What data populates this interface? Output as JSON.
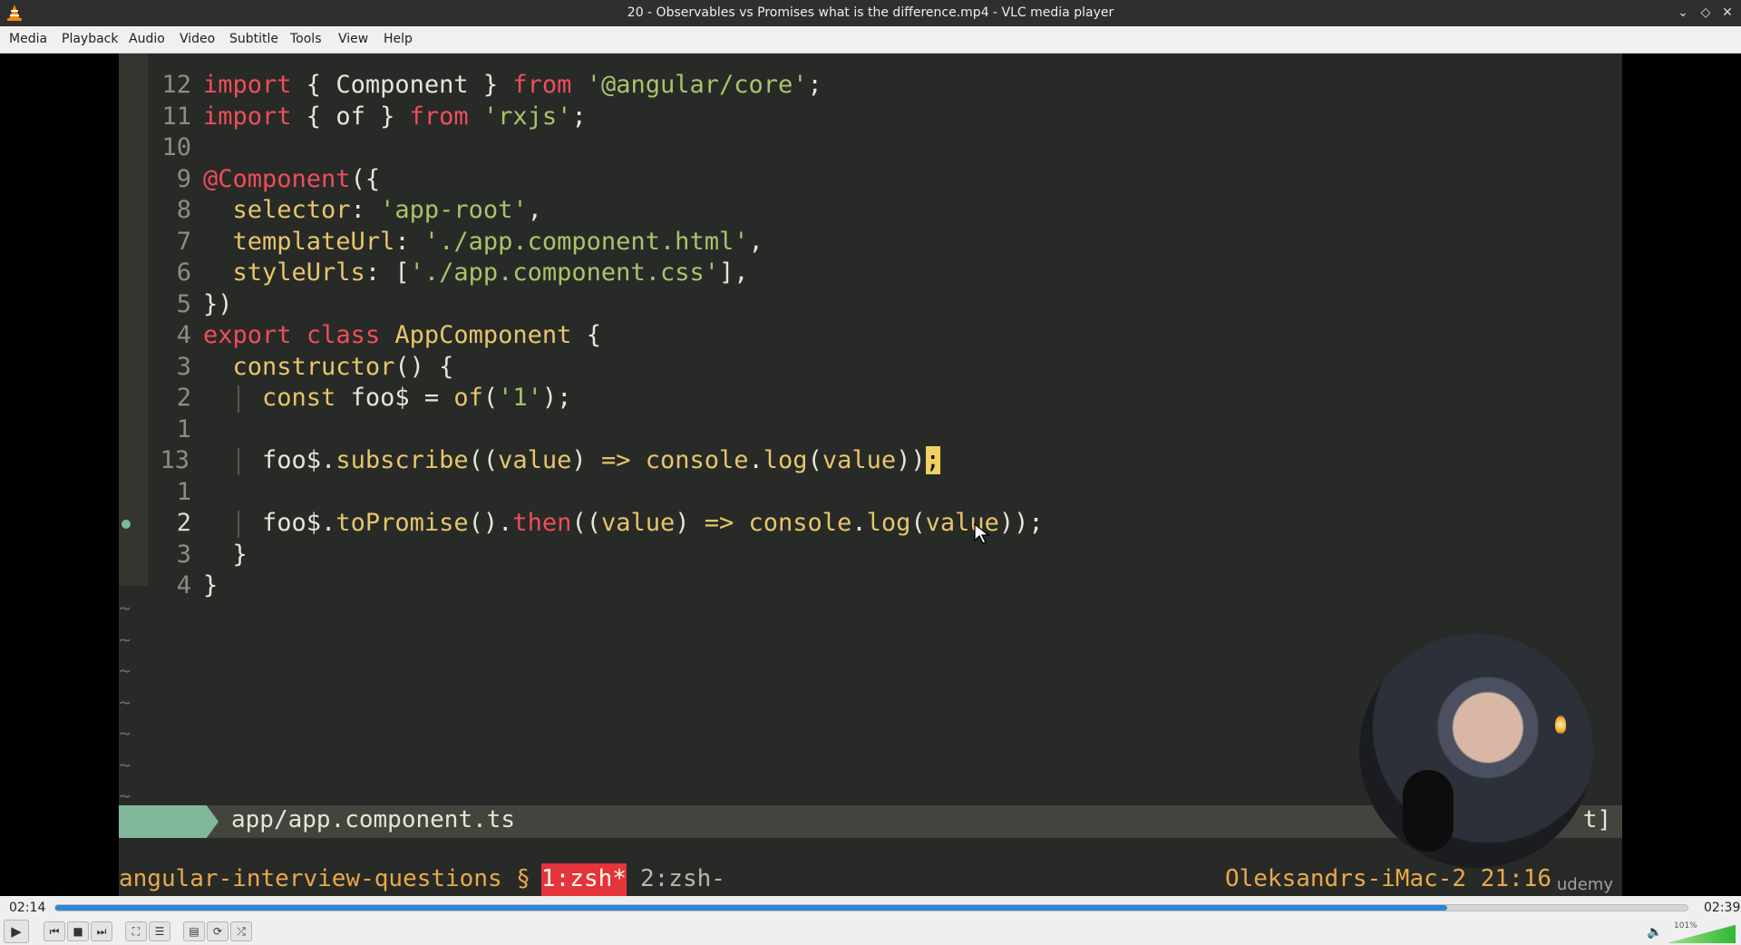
{
  "window": {
    "title": "20 - Observables vs Promises what is the difference.mp4 - VLC media player",
    "controls": [
      "minimize-icon",
      "maximize-icon",
      "close-icon"
    ]
  },
  "menu": [
    "Media",
    "Playback",
    "Audio",
    "Video",
    "Subtitle",
    "Tools",
    "View",
    "Help"
  ],
  "editor": {
    "lines": [
      {
        "num": "12",
        "tokens": [
          [
            "k-red",
            "import"
          ],
          [
            "k-wh",
            " { Component } "
          ],
          [
            "k-red",
            "from"
          ],
          [
            "k-wh",
            " "
          ],
          [
            "k-grn",
            "'@angular/core'"
          ],
          [
            "k-wh",
            ";"
          ]
        ]
      },
      {
        "num": "11",
        "tokens": [
          [
            "k-red",
            "import"
          ],
          [
            "k-wh",
            " { of } "
          ],
          [
            "k-red",
            "from"
          ],
          [
            "k-wh",
            " "
          ],
          [
            "k-grn",
            "'rxjs'"
          ],
          [
            "k-wh",
            ";"
          ]
        ]
      },
      {
        "num": "10",
        "tokens": []
      },
      {
        "num": "9",
        "tokens": [
          [
            "k-red",
            "@Component"
          ],
          [
            "k-wh",
            "({"
          ]
        ]
      },
      {
        "num": "8",
        "tokens": [
          [
            "k-wh",
            "  "
          ],
          [
            "k-yel",
            "selector"
          ],
          [
            "k-wh",
            ": "
          ],
          [
            "k-grn",
            "'app-root'"
          ],
          [
            "k-wh",
            ","
          ]
        ]
      },
      {
        "num": "7",
        "tokens": [
          [
            "k-wh",
            "  "
          ],
          [
            "k-yel",
            "templateUrl"
          ],
          [
            "k-wh",
            ": "
          ],
          [
            "k-grn",
            "'./app.component.html'"
          ],
          [
            "k-wh",
            ","
          ]
        ]
      },
      {
        "num": "6",
        "tokens": [
          [
            "k-wh",
            "  "
          ],
          [
            "k-yel",
            "styleUrls"
          ],
          [
            "k-wh",
            ": ["
          ],
          [
            "k-grn",
            "'./app.component.css'"
          ],
          [
            "k-wh",
            "],"
          ]
        ]
      },
      {
        "num": "5",
        "tokens": [
          [
            "k-wh",
            "})"
          ]
        ]
      },
      {
        "num": "4",
        "tokens": [
          [
            "k-red",
            "export"
          ],
          [
            "k-wh",
            " "
          ],
          [
            "k-red",
            "class"
          ],
          [
            "k-wh",
            " "
          ],
          [
            "k-yel",
            "AppComponent"
          ],
          [
            "k-wh",
            " {"
          ]
        ]
      },
      {
        "num": "3",
        "tokens": [
          [
            "k-wh",
            "  "
          ],
          [
            "k-yel",
            "constructor"
          ],
          [
            "k-wh",
            "() {"
          ]
        ]
      },
      {
        "num": "2",
        "tokens": [
          [
            "k-wh",
            "    "
          ],
          [
            "k-yel",
            "const"
          ],
          [
            "k-wh",
            " foo$ = "
          ],
          [
            "k-yel",
            "of"
          ],
          [
            "k-wh",
            "("
          ],
          [
            "k-grn",
            "'1'"
          ],
          [
            "k-wh",
            ");"
          ]
        ]
      },
      {
        "num": "1",
        "tokens": []
      },
      {
        "num": "13",
        "tokens": [
          [
            "k-wh",
            "    foo$."
          ],
          [
            "k-yel",
            "subscribe"
          ],
          [
            "k-wh",
            "(("
          ],
          [
            "k-yel",
            "value"
          ],
          [
            "k-wh",
            ") "
          ],
          [
            "k-yel",
            "=>"
          ],
          [
            "k-wh",
            " "
          ],
          [
            "k-yel",
            "console"
          ],
          [
            "k-wh",
            "."
          ],
          [
            "k-yel",
            "log"
          ],
          [
            "k-wh",
            "("
          ],
          [
            "k-yel",
            "value"
          ],
          [
            "k-wh",
            "))"
          ],
          [
            "cursor",
            ";"
          ]
        ]
      },
      {
        "num": "1",
        "tokens": []
      },
      {
        "num": "2",
        "tokens": [
          [
            "k-wh",
            "    foo$."
          ],
          [
            "k-yel",
            "toPromise"
          ],
          [
            "k-wh",
            "()."
          ],
          [
            "k-red",
            "then"
          ],
          [
            "k-wh",
            "(("
          ],
          [
            "k-yel",
            "value"
          ],
          [
            "k-wh",
            ") "
          ],
          [
            "k-yel",
            "=>"
          ],
          [
            "k-wh",
            " "
          ],
          [
            "k-yel",
            "console"
          ],
          [
            "k-wh",
            "."
          ],
          [
            "k-yel",
            "log"
          ],
          [
            "k-wh",
            "("
          ],
          [
            "k-yel",
            "value"
          ],
          [
            "k-wh",
            "));"
          ]
        ]
      },
      {
        "num": "3",
        "tokens": [
          [
            "k-wh",
            "  }"
          ]
        ]
      },
      {
        "num": "4",
        "tokens": [
          [
            "k-wh",
            "}"
          ]
        ]
      }
    ],
    "tilde": "~",
    "status_file": "app/app.component.ts",
    "status_right": "t]"
  },
  "tmux": {
    "session": "angular-interview-questions §",
    "window1": "1:zsh*",
    "window2": "2:zsh-",
    "host": "Oleksandrs-iMac-2 21:16"
  },
  "watermark": "udemy",
  "player": {
    "elapsed": "02:14",
    "total": "02:39",
    "progress_fraction": 0.853,
    "volume_label": "101%",
    "volume_fraction": 1.0
  }
}
